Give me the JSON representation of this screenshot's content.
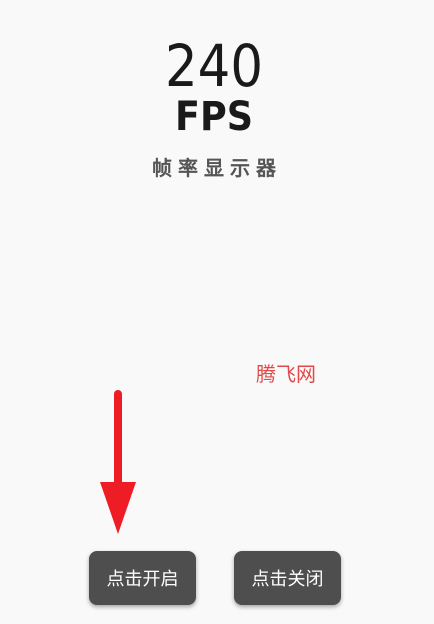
{
  "logo": {
    "number": "240",
    "unit": "FPS"
  },
  "subtitle": "帧率显示器",
  "watermark": "腾飞网",
  "arrow": {
    "color": "#ee1c24"
  },
  "buttons": {
    "start_label": "点击开启",
    "stop_label": "点击关闭"
  },
  "colors": {
    "background": "#f9f9f9",
    "button_bg": "#4e4e4e",
    "button_text": "#ffffff",
    "logo": "#1a1a1a",
    "subtitle": "#555555",
    "watermark": "#e04a4a"
  }
}
